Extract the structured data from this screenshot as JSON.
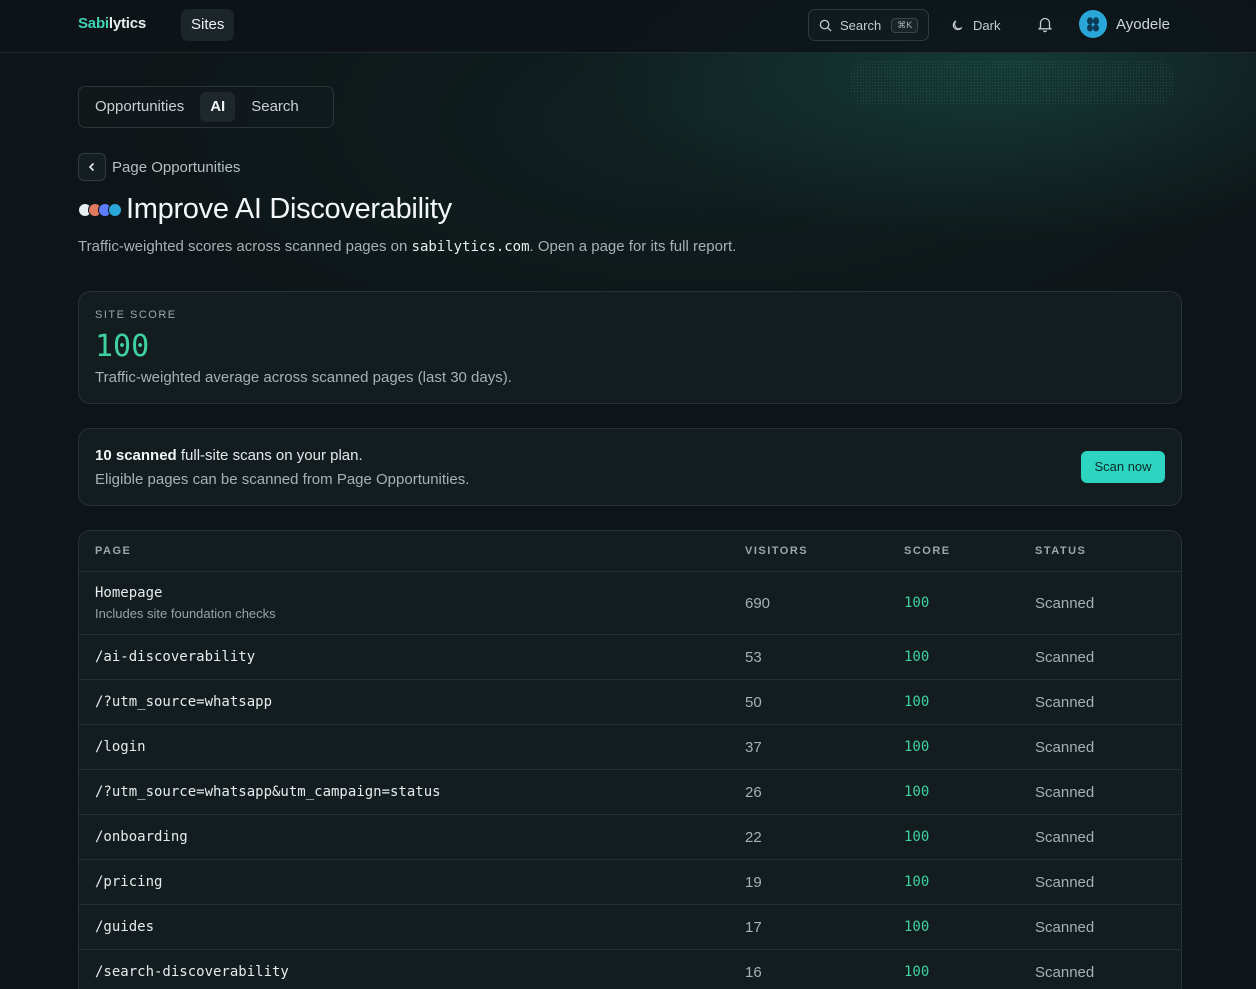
{
  "topbar": {
    "logo_part1": "Sabi",
    "logo_part2": "lytics",
    "sites_label": "Sites",
    "search_label": "Search",
    "search_shortcut": "⌘K",
    "theme_label": "Dark",
    "user_name": "Ayodele"
  },
  "tabs": [
    {
      "label": "Opportunities",
      "active": false
    },
    {
      "label": "AI",
      "active": true
    },
    {
      "label": "Search",
      "active": false
    }
  ],
  "breadcrumb": {
    "back_label": "Page Opportunities"
  },
  "page": {
    "title": "Improve AI Discoverability",
    "subtitle_pre": "Traffic-weighted scores across scanned pages on ",
    "subtitle_domain": "sabilytics.com",
    "subtitle_post": ". Open a page for its full report."
  },
  "site_score": {
    "label": "SITE SCORE",
    "value": "100",
    "description": "Traffic-weighted average across scanned pages (last 30 days)."
  },
  "plan": {
    "count_text": "10 scanned",
    "line1_rest": " full-site scans on your plan.",
    "line2": "Eligible pages can be scanned from Page Opportunities.",
    "scan_button": "Scan now"
  },
  "table": {
    "headers": {
      "page": "PAGE",
      "visitors": "VISITORS",
      "score": "SCORE",
      "status": "STATUS"
    },
    "rows": [
      {
        "page": "Homepage",
        "sub": "Includes site foundation checks",
        "visitors": "690",
        "score": "100",
        "status": "Scanned"
      },
      {
        "page": "/ai-discoverability",
        "sub": "",
        "visitors": "53",
        "score": "100",
        "status": "Scanned"
      },
      {
        "page": "/?utm_source=whatsapp",
        "sub": "",
        "visitors": "50",
        "score": "100",
        "status": "Scanned"
      },
      {
        "page": "/login",
        "sub": "",
        "visitors": "37",
        "score": "100",
        "status": "Scanned"
      },
      {
        "page": "/?utm_source=whatsapp&utm_campaign=status",
        "sub": "",
        "visitors": "26",
        "score": "100",
        "status": "Scanned"
      },
      {
        "page": "/onboarding",
        "sub": "",
        "visitors": "22",
        "score": "100",
        "status": "Scanned"
      },
      {
        "page": "/pricing",
        "sub": "",
        "visitors": "19",
        "score": "100",
        "status": "Scanned"
      },
      {
        "page": "/guides",
        "sub": "",
        "visitors": "17",
        "score": "100",
        "status": "Scanned"
      },
      {
        "page": "/search-discoverability",
        "sub": "",
        "visitors": "16",
        "score": "100",
        "status": "Scanned"
      }
    ]
  },
  "colors": {
    "accent": "#2dd4bf",
    "score_green": "#3fd2a0",
    "background": "#0e1417"
  }
}
